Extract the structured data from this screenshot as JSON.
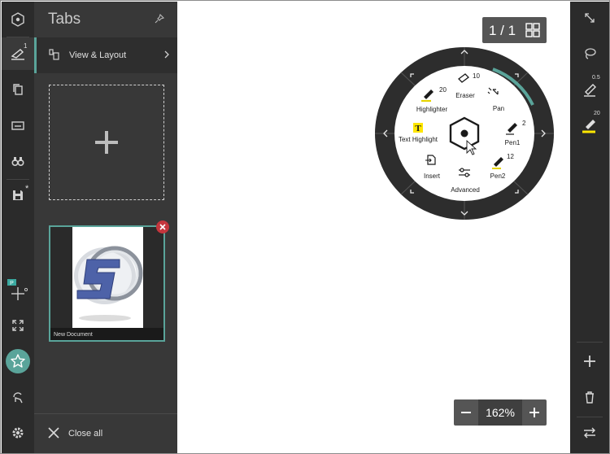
{
  "panel": {
    "title": "Tabs",
    "view_layout_label": "View & Layout",
    "close_all_label": "Close all",
    "document": {
      "name": "New Document"
    }
  },
  "rail": {
    "ink_badge": "1",
    "save_marker": "*",
    "items": [
      "toggle-icon",
      "ink-icon",
      "copy-icon",
      "keyboard-icon",
      "binoculars-icon",
      "save-icon",
      "add-point-icon",
      "fit-screen-icon",
      "favorites-star-icon",
      "refresh-hand-icon",
      "settings-gear-icon"
    ]
  },
  "canvas": {
    "page_indicator": "1 / 1",
    "zoom_value": "162%"
  },
  "radial_menu": {
    "items": [
      {
        "label": "Eraser",
        "value": "10"
      },
      {
        "label": "Pan",
        "value": ""
      },
      {
        "label": "Pen1",
        "value": "2"
      },
      {
        "label": "Pen2",
        "value": "12"
      },
      {
        "label": "Advanced",
        "value": ""
      },
      {
        "label": "Insert",
        "value": ""
      },
      {
        "label": "Text Highlight",
        "value": ""
      },
      {
        "label": "Highlighter",
        "value": "20"
      }
    ]
  },
  "right_rail": {
    "pen_size": "0.5",
    "highlighter_size": "20"
  },
  "colors": {
    "accent": "#5aa49a",
    "close_badge": "#c4363d",
    "highlight": "#ffe600"
  }
}
